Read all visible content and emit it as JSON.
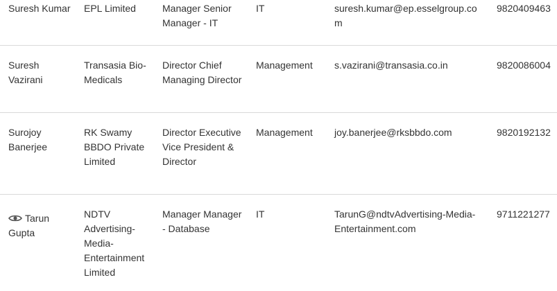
{
  "rows": [
    {
      "name": "Suresh Kumar",
      "company": "EPL Limited",
      "title": "Manager Senior Manager - IT",
      "department": "IT",
      "email": "suresh.kumar@ep.esselgroup.com",
      "phone": "9820409463"
    },
    {
      "name": "Suresh Vazirani",
      "company": "Transasia Bio-Medicals",
      "title": "Director Chief Managing Director",
      "department": "Management",
      "email": "s.vazirani@transasia.co.in",
      "phone": "9820086004"
    },
    {
      "name": "Surojoy Banerjee",
      "company": "RK Swamy BBDO Private Limited",
      "title": "Director Executive Vice President & Director",
      "department": "Management",
      "email": "joy.banerjee@rksbbdo.com",
      "phone": "9820192132"
    },
    {
      "name": "Tarun Gupta",
      "company": "NDTV Advertising-Media-Entertainment Limited",
      "title": "Manager Manager - Database",
      "department": "IT",
      "email": "TarunG@ndtvAdvertising-Media-Entertainment.com",
      "phone": "9711221277",
      "icon": "eye-icon"
    }
  ]
}
